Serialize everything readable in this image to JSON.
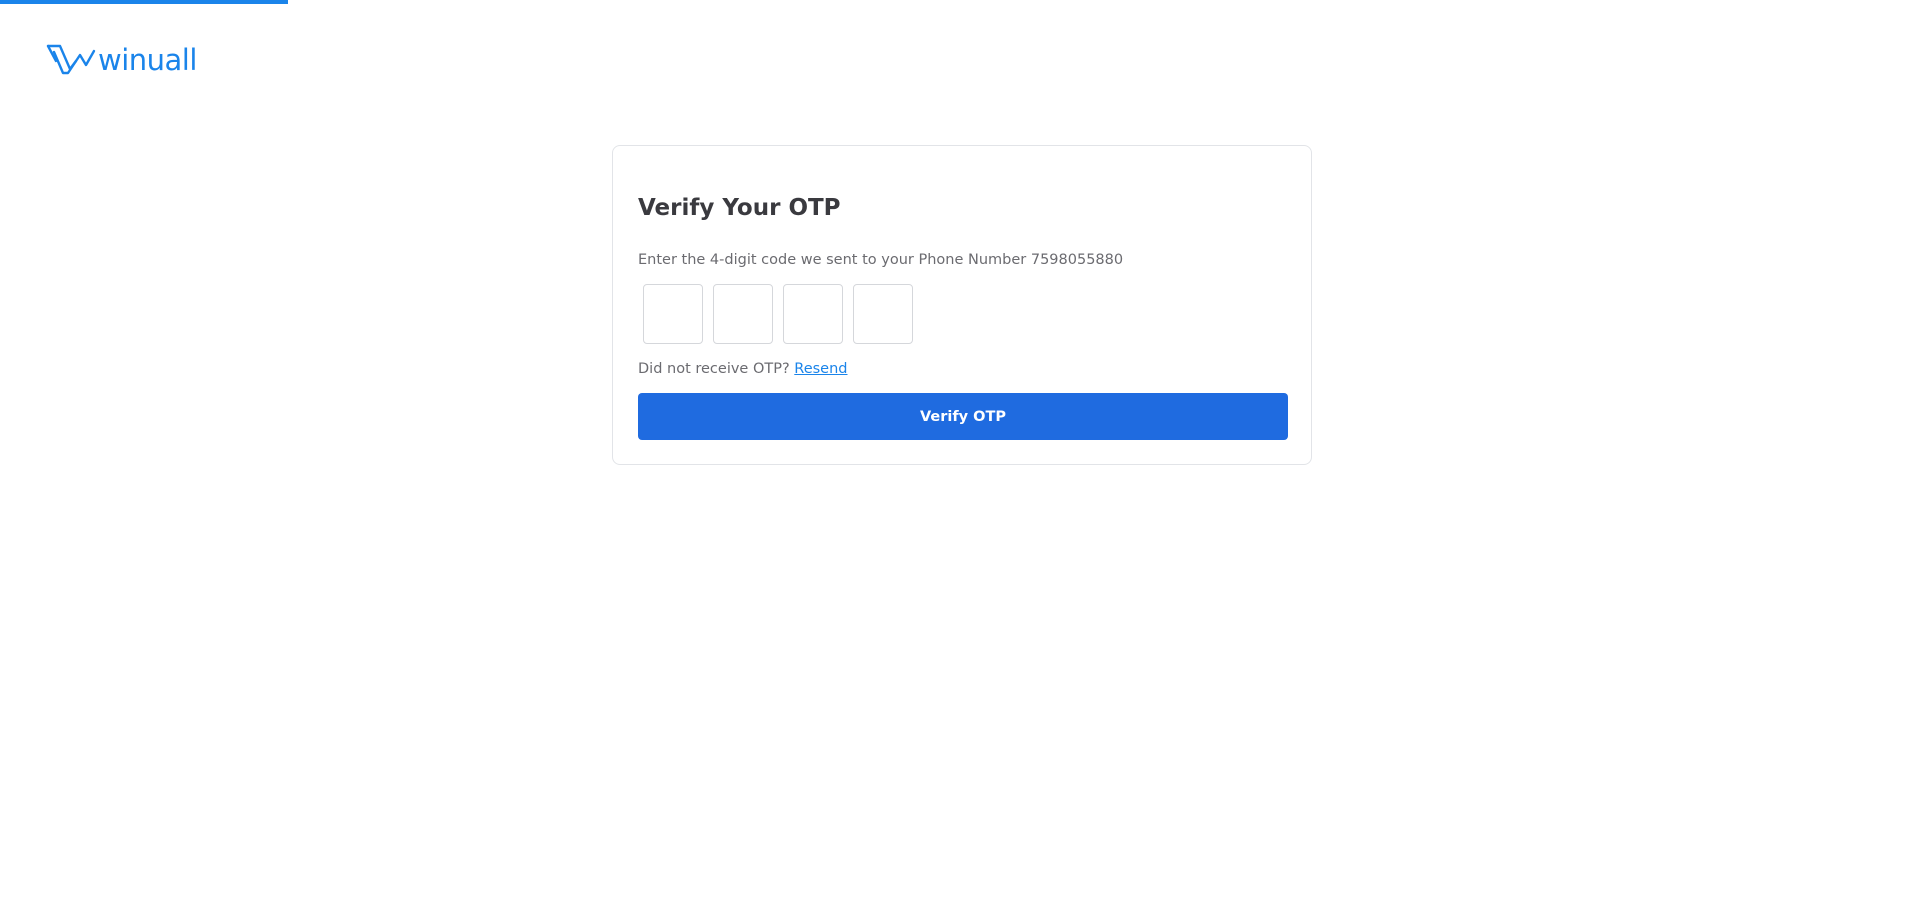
{
  "page": {
    "progress_percent": 15
  },
  "brand": {
    "name": "winuall",
    "color": "#1a84ea",
    "logo_icon": "winuall-logo-icon"
  },
  "otp_card": {
    "title": "Verify Your OTP",
    "description": "Enter the 4-digit code we sent to your Phone Number 7598055880",
    "digits": [
      "",
      "",
      "",
      ""
    ],
    "resend_prompt": "Did not receive OTP?",
    "resend_label": "Resend",
    "verify_label": "Verify OTP",
    "button_color": "#1f6be0",
    "link_color": "#1a84ea"
  }
}
